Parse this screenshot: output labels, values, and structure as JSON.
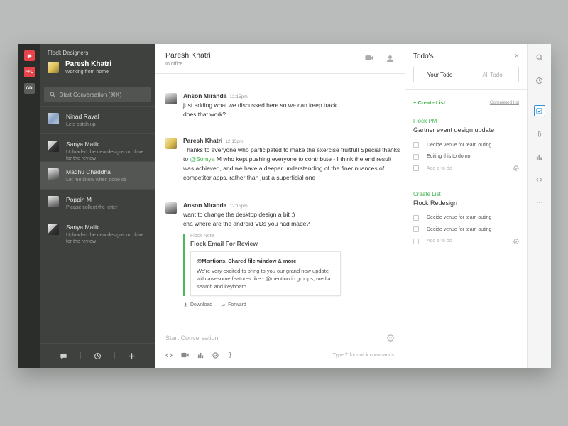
{
  "teams": [
    {
      "name": "flock-team",
      "label": "",
      "color": "#e8434b"
    },
    {
      "name": "red-team",
      "label": "FFL",
      "color": "#e8434b"
    },
    {
      "name": "gd-team",
      "label": "GD",
      "color": "#5a5d5a"
    }
  ],
  "sidebar": {
    "team_name": "Flock Designers",
    "user_name": "Paresh Khatri",
    "user_status": "Working from home",
    "search_placeholder": "Start Conversation (⌘K)",
    "conversations": [
      {
        "name": "Ninad Raval",
        "sub": "Lets catch up"
      },
      {
        "name": "Sanya Malik",
        "sub": "Uploaded the new designs on drive for the review"
      },
      {
        "name": "Madhu Chaddha",
        "sub": "Let me know when done sir"
      },
      {
        "name": "Poppin M",
        "sub": "Please collect the letter"
      },
      {
        "name": "Sanya Malik",
        "sub": "Uploaded the new designs on drive for the review"
      }
    ]
  },
  "chat": {
    "title": "Paresh Khatri",
    "subtitle": "In office",
    "messages": [
      {
        "author": "Anson Miranda",
        "time": "12:15pm",
        "lines": [
          "just adding what we discussed here so we can keep track",
          "does that work?"
        ]
      },
      {
        "author": "Paresh Khatri",
        "time": "12:15pm",
        "line1": "Thanks to everyone who participated to make the exercise fruitful! Special thanks",
        "line2_pre": "to ",
        "mention": "@Somya",
        "line2_post": " M who kept pushing everyone to contribute - I think the end result",
        "line3": "was achieved, and we have a deeper understanding of the finer nuances of",
        "line4": "competitor apps, rather than just a superficial one"
      },
      {
        "author": "Anson Miranda",
        "time": "12:15pm",
        "lines": [
          "want to change the desktop design a bit :)",
          "cha where are the android VDs you had made?"
        ]
      }
    ],
    "note": {
      "label": "Flock Note",
      "title": "Flock Email For Review",
      "card_title": "@Mentions, Shared file window & more",
      "card_text": "We're very excited to bring to you our grand new update with awesome features like - @mention in groups, media search and keyboard ...",
      "download": "Download",
      "forward": "Forward"
    },
    "compose_placeholder": "Start Conversation",
    "hint": "Type '/' for quick commands"
  },
  "todo": {
    "title": "Todo's",
    "close": "×",
    "tabs": [
      "Your Todo",
      "All Todo"
    ],
    "create_list": "+ Create List",
    "completed_list": "Completed list",
    "lists": [
      {
        "label": "Flock PM",
        "name": "Gartner event design update",
        "items": [
          "Decide venue for team outing",
          "Editing this to do no|"
        ],
        "add": "Add a to do"
      },
      {
        "label": "Create List",
        "name": "Flock Redesign",
        "items": [
          "Decide venue for team outing",
          "Decide venue for team outing"
        ],
        "add": "Add a to do"
      }
    ]
  }
}
